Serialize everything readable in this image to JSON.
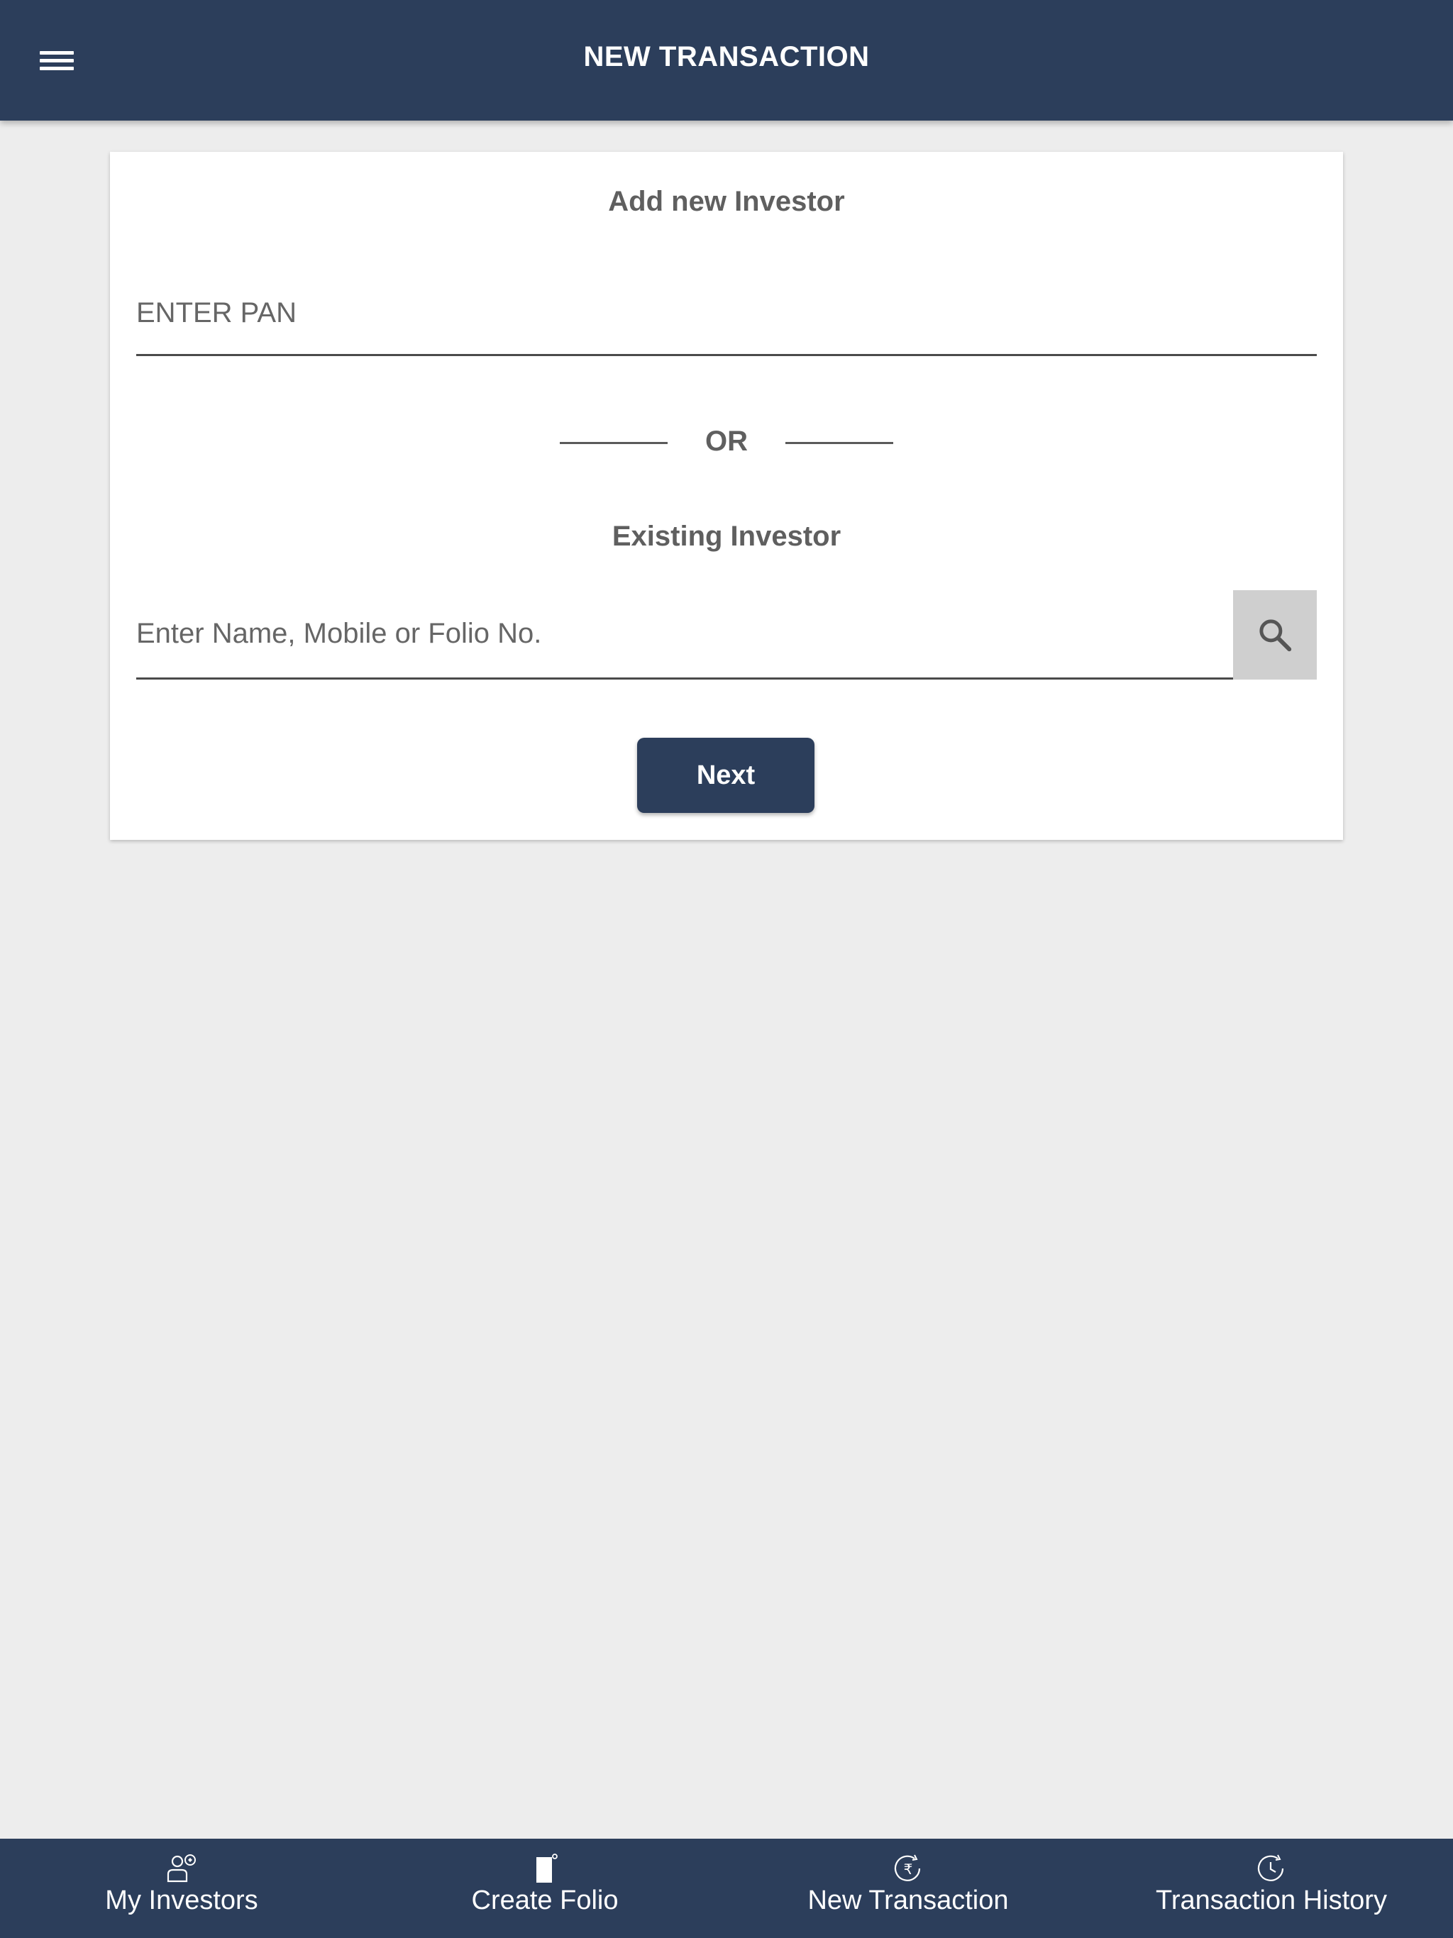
{
  "header": {
    "title": "NEW TRANSACTION",
    "menu_icon": "hamburger-menu-icon"
  },
  "card": {
    "add_heading": "Add new Investor",
    "pan_placeholder": "ENTER PAN",
    "pan_value": "",
    "or_label": "OR",
    "existing_heading": "Existing Investor",
    "search_placeholder": "Enter Name, Mobile or Folio No.",
    "search_value": "",
    "search_icon": "search-icon",
    "next_label": "Next"
  },
  "tabs": [
    {
      "label": "My Investors",
      "icon": "investors-icon"
    },
    {
      "label": "Create Folio",
      "icon": "folio-icon"
    },
    {
      "label": "New Transaction",
      "icon": "rupee-transaction-icon"
    },
    {
      "label": "Transaction History",
      "icon": "history-clock-icon"
    }
  ],
  "colors": {
    "primary": "#2c3e5b",
    "background": "#ededed",
    "card": "#ffffff",
    "search_button": "#cfcfcf"
  }
}
